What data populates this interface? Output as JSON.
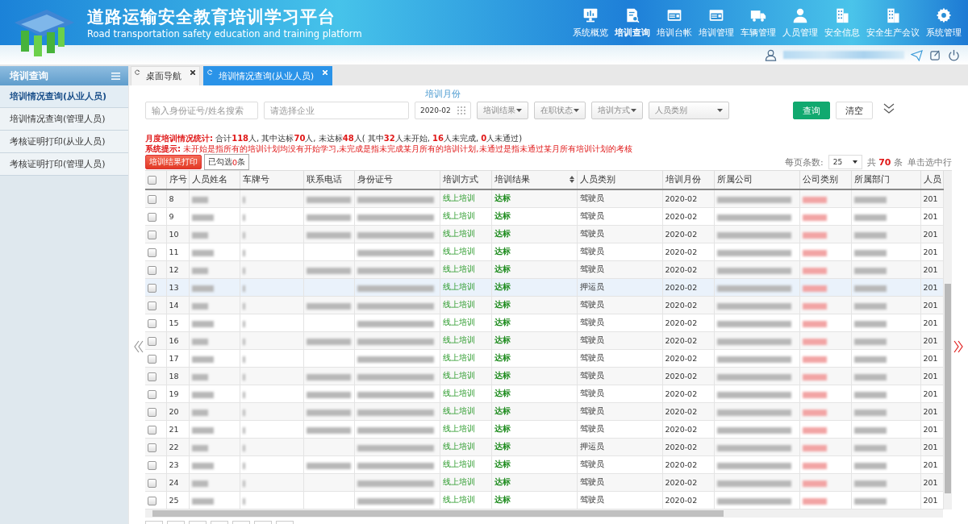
{
  "header": {
    "title": "道路运输安全教育培训学习平台",
    "subtitle": "Road transportation safety education and training platform",
    "nav": [
      {
        "label": "系统概览",
        "selected": false
      },
      {
        "label": "培训查询",
        "selected": true
      },
      {
        "label": "培训台帐",
        "selected": false
      },
      {
        "label": "培训管理",
        "selected": false
      },
      {
        "label": "车辆管理",
        "selected": false
      },
      {
        "label": "人员管理",
        "selected": false
      },
      {
        "label": "安全信息",
        "selected": false
      },
      {
        "label": "安全生产会议",
        "selected": false
      },
      {
        "label": "系统管理",
        "selected": false
      }
    ]
  },
  "sidebar": {
    "title": "培训查询",
    "items": [
      {
        "label": "培训情况查询(从业人员)",
        "selected": true
      },
      {
        "label": "培训情况查询(管理人员)",
        "selected": false
      },
      {
        "label": "考核证明打印(从业人员)",
        "selected": false
      },
      {
        "label": "考核证明打印(管理人员)",
        "selected": false
      }
    ]
  },
  "tabs": [
    {
      "label": "桌面导航",
      "selected": false
    },
    {
      "label": "培训情况查询(从业人员)",
      "selected": true
    }
  ],
  "filters": {
    "id_search": {
      "placeholder": "输入身份证号/姓名搜索"
    },
    "company": {
      "placeholder": "请选择企业"
    },
    "month_label": "培训月份",
    "month": {
      "value": "2020-02"
    },
    "selects": [
      "培训结果",
      "在职状态",
      "培训方式",
      "人员类别"
    ],
    "query_button": "查询",
    "clear_button": "清空"
  },
  "stats": {
    "label": "月度培训情况统计:",
    "text": "合计**118**人, 其中达标**70**人, 未达标**48**人( 其中**32**人未开始, **16**人未完成, **0**人未通过)"
  },
  "hint": {
    "label": "系统提示:",
    "text": "未开始是指所有的培训计划均没有开始学习,未完成是指未完成某月所有的培训计划,未通过是指未通过某月所有培训计划的考核"
  },
  "print_button": "培训结果打印",
  "selected_count": "已勾选**0**条",
  "pager": {
    "per_page_label": "每页条数:",
    "per_page": "25",
    "total": "共 **70** 条",
    "hint": "单击选中行"
  },
  "table": {
    "header_checked": false,
    "columns": [
      "序号",
      "人员姓名",
      "车牌号",
      "联系电话",
      "身份证号",
      "培训方式",
      "培训结果",
      "人员类别",
      "培训月份",
      "所属公司",
      "公司类别",
      "所属部门",
      "人员"
    ],
    "rows": [
      {
        "no": "8",
        "phone_shown": true,
        "method": "线上培训",
        "result": "达标",
        "category": "驾驶员",
        "month": "2020-02",
        "column_13": "201",
        "checked": false,
        "selected": false
      },
      {
        "no": "9",
        "phone_shown": true,
        "method": "线上培训",
        "result": "达标",
        "category": "驾驶员",
        "month": "2020-02",
        "column_13": "201",
        "checked": false,
        "selected": false
      },
      {
        "no": "10",
        "phone_shown": true,
        "method": "线上培训",
        "result": "达标",
        "category": "驾驶员",
        "month": "2020-02",
        "column_13": "201",
        "checked": false,
        "selected": false
      },
      {
        "no": "11",
        "phone_shown": false,
        "method": "线上培训",
        "result": "达标",
        "category": "驾驶员",
        "month": "2020-02",
        "column_13": "201",
        "checked": false,
        "selected": false
      },
      {
        "no": "12",
        "phone_shown": true,
        "method": "线上培训",
        "result": "达标",
        "category": "驾驶员",
        "month": "2020-02",
        "column_13": "201",
        "checked": false,
        "selected": false
      },
      {
        "no": "13",
        "phone_shown": false,
        "method": "线上培训",
        "result": "达标",
        "category": "押运员",
        "month": "2020-02",
        "column_13": "201",
        "checked": false,
        "selected": true
      },
      {
        "no": "14",
        "phone_shown": true,
        "method": "线上培训",
        "result": "达标",
        "category": "驾驶员",
        "month": "2020-02",
        "column_13": "201",
        "checked": false,
        "selected": false
      },
      {
        "no": "15",
        "phone_shown": false,
        "method": "线上培训",
        "result": "达标",
        "category": "驾驶员",
        "month": "2020-02",
        "column_13": "201",
        "checked": false,
        "selected": false
      },
      {
        "no": "16",
        "phone_shown": true,
        "method": "线上培训",
        "result": "达标",
        "category": "驾驶员",
        "month": "2020-02",
        "column_13": "201",
        "checked": false,
        "selected": false
      },
      {
        "no": "17",
        "phone_shown": false,
        "method": "线上培训",
        "result": "达标",
        "category": "驾驶员",
        "month": "2020-02",
        "column_13": "201",
        "checked": false,
        "selected": false
      },
      {
        "no": "18",
        "phone_shown": true,
        "method": "线上培训",
        "result": "达标",
        "category": "驾驶员",
        "month": "2020-02",
        "column_13": "201",
        "checked": false,
        "selected": false
      },
      {
        "no": "19",
        "phone_shown": true,
        "method": "线上培训",
        "result": "达标",
        "category": "驾驶员",
        "month": "2020-02",
        "column_13": "201",
        "checked": false,
        "selected": false
      },
      {
        "no": "20",
        "phone_shown": true,
        "method": "线上培训",
        "result": "达标",
        "category": "驾驶员",
        "month": "2020-02",
        "column_13": "201",
        "checked": false,
        "selected": false
      },
      {
        "no": "21",
        "phone_shown": true,
        "method": "线上培训",
        "result": "达标",
        "category": "驾驶员",
        "month": "2020-02",
        "column_13": "201",
        "checked": false,
        "selected": false
      },
      {
        "no": "22",
        "phone_shown": false,
        "method": "线上培训",
        "result": "达标",
        "category": "押运员",
        "month": "2020-02",
        "column_13": "201",
        "checked": false,
        "selected": false
      },
      {
        "no": "23",
        "phone_shown": true,
        "method": "线上培训",
        "result": "达标",
        "category": "驾驶员",
        "month": "2020-02",
        "column_13": "201",
        "checked": false,
        "selected": false
      },
      {
        "no": "24",
        "phone_shown": false,
        "method": "线上培训",
        "result": "达标",
        "category": "驾驶员",
        "month": "2020-02",
        "column_13": "201",
        "checked": false,
        "selected": false
      },
      {
        "no": "25",
        "phone_shown": false,
        "method": "线上培训",
        "result": "达标",
        "category": "驾驶员",
        "month": "2020-02",
        "column_13": "201",
        "checked": false,
        "selected": false
      }
    ]
  }
}
